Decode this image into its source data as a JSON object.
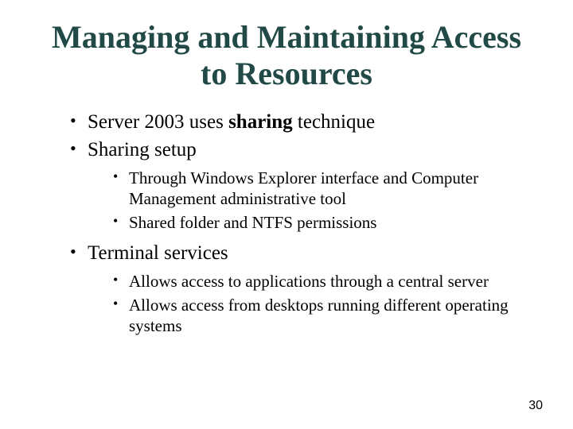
{
  "title": "Managing and Maintaining Access to Resources",
  "bullets": {
    "b1_pre": "Server 2003 uses ",
    "b1_bold": "sharing",
    "b1_post": " technique",
    "b2": "Sharing setup",
    "b2_sub1": "Through Windows Explorer interface and Computer Management administrative tool",
    "b2_sub2": "Shared folder and NTFS permissions",
    "b3": "Terminal services",
    "b3_sub1": "Allows access to applications through a central server",
    "b3_sub2": "Allows access from desktops running different operating systems"
  },
  "page_number": "30"
}
